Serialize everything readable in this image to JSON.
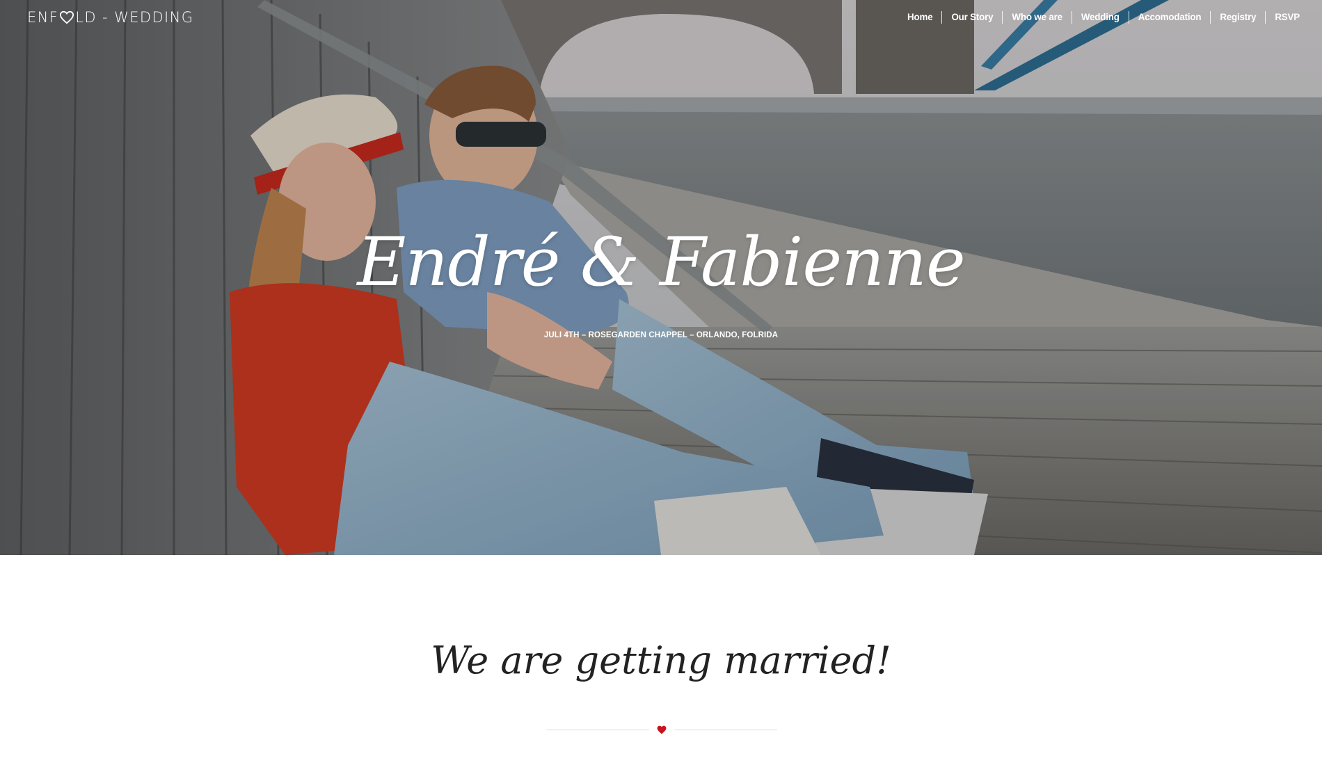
{
  "header": {
    "logo_left": "ENF",
    "logo_right": "LD - WEDDING",
    "logo_icon": "heart-outline-icon",
    "nav": [
      {
        "label": "Home"
      },
      {
        "label": "Our Story"
      },
      {
        "label": "Who we are"
      },
      {
        "label": "Wedding"
      },
      {
        "label": "Accomodation"
      },
      {
        "label": "Registry"
      },
      {
        "label": "RSVP"
      }
    ]
  },
  "hero": {
    "title": "Endré & Fabienne",
    "subtitle": "JULI 4TH – ROSEGARDEN CHAPPEL – ORLANDO, FOLRIDA",
    "background_image": "couple-sitting-on-boardwalk-photo"
  },
  "intro": {
    "heading": "We are getting married!",
    "divider_icon": "heart-icon",
    "accent_color": "#c4161c"
  }
}
